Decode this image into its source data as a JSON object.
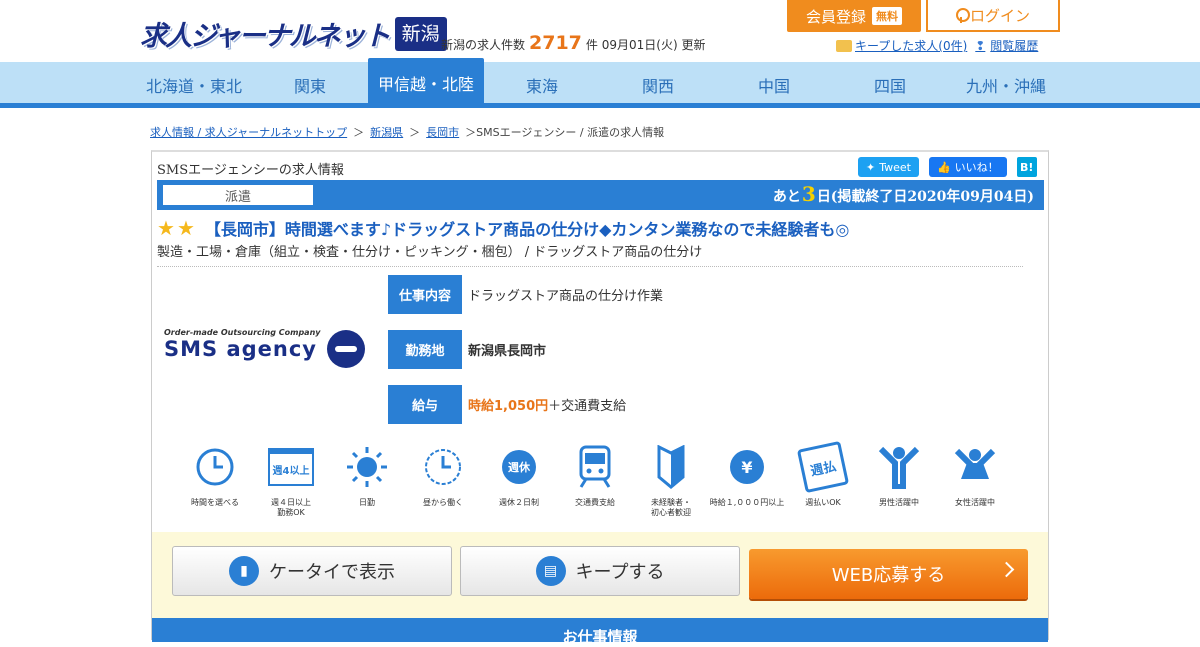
{
  "header": {
    "logo": "求人ジャーナルネット",
    "region": "新潟",
    "count_prefix": "新潟の求人件数",
    "count": "2717",
    "count_suffix": "件 09月01日(火) 更新",
    "register_label": "会員登録",
    "free_label": "無料",
    "login_label": "ログイン",
    "kept_label": "キープした求人(0件)",
    "history_label": "閲覧履歴"
  },
  "nav": [
    "北海道・東北",
    "関東",
    "甲信越・北陸",
    "東海",
    "関西",
    "中国",
    "四国",
    "九州・沖縄"
  ],
  "breadcrumb": {
    "home": "求人情報 / 求人ジャーナルネットトップ",
    "pref": "新潟県",
    "city": "長岡市",
    "current": "＞SMSエージェンシー / 派遣の求人情報"
  },
  "job": {
    "card_title": "SMSエージェンシーの求人情報",
    "tweet": "Tweet",
    "like": "いいね！",
    "hatena": "B!",
    "type": "派遣",
    "deadline_prefix": "あと",
    "deadline_days": "3",
    "deadline_suffix": "日(掲載終了日2020年09月04日)",
    "title": "【長岡市】時間選べます♪ドラッグストア商品の仕分け◆カンタン業務なので未経験者も◎",
    "subtitle": "製造・工場・倉庫（組立・検査・仕分け・ピッキング・梱包） / ドラッグストア商品の仕分け",
    "company_small": "Order-made Outsourcing Company",
    "company_main": "SMS agency",
    "info": [
      {
        "label": "仕事内容",
        "value": "ドラッグストア商品の仕分け作業"
      },
      {
        "label": "勤務地",
        "value": "新潟県長岡市"
      },
      {
        "label": "給与",
        "wage": "時給1,050円",
        "extra": "＋交通費支給"
      }
    ]
  },
  "features": [
    {
      "icon": "clock-icon",
      "label": "時間を選べる",
      "glyph": "◔"
    },
    {
      "icon": "calendar-icon",
      "label": "週４日以上\n勤務OK",
      "glyph": "週4以上"
    },
    {
      "icon": "sun-icon",
      "label": "日勤",
      "glyph": "☀"
    },
    {
      "icon": "clock-arrow-icon",
      "label": "昼から働く",
      "glyph": "◔"
    },
    {
      "icon": "weekly-off-icon",
      "label": "週休２日制",
      "glyph": "週休"
    },
    {
      "icon": "train-icon",
      "label": "交通費支給",
      "glyph": "▣"
    },
    {
      "icon": "beginner-mark-icon",
      "label": "未経験者・\n初心者歓迎",
      "glyph": "❦"
    },
    {
      "icon": "yen-icon",
      "label": "時給１,０００円以上",
      "glyph": "¥"
    },
    {
      "icon": "weekly-pay-icon",
      "label": "週払いOK",
      "glyph": "週払"
    },
    {
      "icon": "male-icon",
      "label": "男性活躍中",
      "glyph": "Y"
    },
    {
      "icon": "female-icon",
      "label": "女性活躍中",
      "glyph": "Y"
    }
  ],
  "actions": {
    "mobile": "ケータイで表示",
    "keep": "キープする",
    "apply": "WEB応募する"
  },
  "bottom": "お仕事情報",
  "colors": {
    "primary": "#2a7fd4",
    "accent": "#f08c1e",
    "navy": "#1a2f86"
  }
}
